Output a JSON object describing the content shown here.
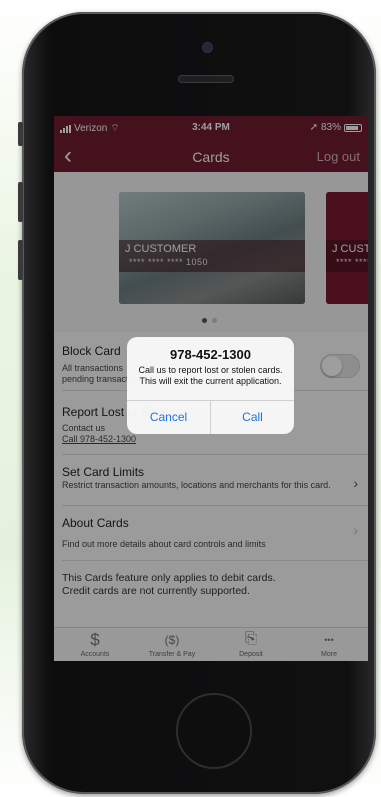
{
  "status_bar": {
    "carrier": "Verizon",
    "time": "3:44 PM",
    "battery": "83%"
  },
  "navbar": {
    "back_icon": "chevron-left-icon",
    "title": "Cards",
    "logout": "Log out"
  },
  "cards": [
    {
      "name": "J CUSTOMER",
      "masked_number": "**** **** **** 1050"
    },
    {
      "name": "J CUST",
      "masked_number": "**** ****"
    }
  ],
  "carousel": {
    "pages": 2,
    "active_page": 0
  },
  "block_card": {
    "title": "Block Card",
    "desc_line1": "All transactions",
    "desc_line2": "pending transactions"
  },
  "report_lost": {
    "title": "Report Lost or Stolen",
    "desc_line1": "Contact us",
    "desc_line2": "Call 978-452-1300"
  },
  "set_limits": {
    "title": "Set Card Limits",
    "desc": "Restrict transaction amounts, locations and merchants for this card."
  },
  "about_cards": {
    "title": "About Cards",
    "desc": "Find out more details about card controls and limits"
  },
  "footer_note": "This Cards feature only applies to debit cards. Credit cards are not currently supported.",
  "tabs": [
    {
      "label": "Accounts",
      "icon": "dollar-icon",
      "glyph": "$"
    },
    {
      "label": "Transfer & Pay",
      "icon": "transfer-pay-icon",
      "glyph": "($)"
    },
    {
      "label": "Deposit",
      "icon": "deposit-check-icon",
      "glyph": "⎘"
    },
    {
      "label": "More",
      "icon": "more-dots-icon",
      "glyph": "•••"
    }
  ],
  "alert": {
    "title": "978-452-1300",
    "message": "Call us to report lost or stolen cards. This will exit the current application.",
    "cancel": "Cancel",
    "call": "Call"
  },
  "colors": {
    "brand": "#6e1c2e",
    "link": "#1e72e6"
  }
}
